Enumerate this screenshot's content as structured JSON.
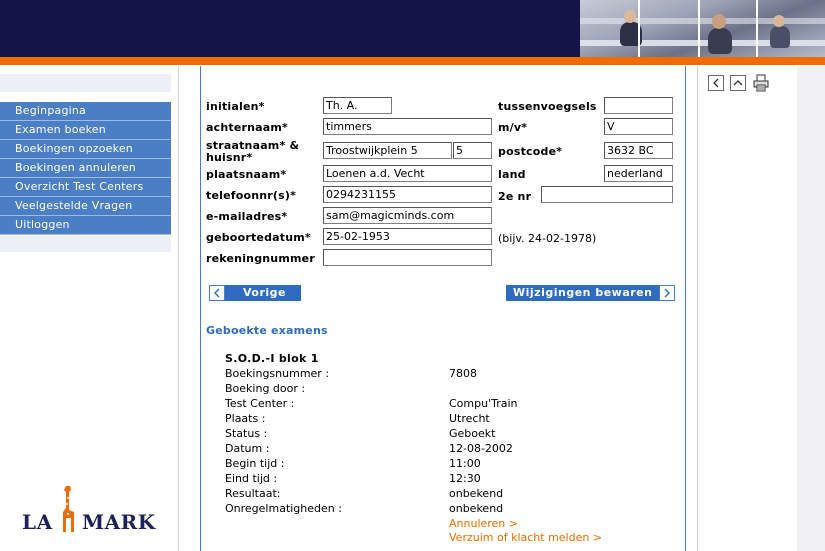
{
  "nav": {
    "items": [
      {
        "label": "Beginpagina"
      },
      {
        "label": "Examen boeken"
      },
      {
        "label": "Boekingen opzoeken"
      },
      {
        "label": "Boekingen annuleren"
      },
      {
        "label": "Overzicht Test Centers"
      },
      {
        "label": "Veelgestelde Vragen"
      },
      {
        "label": "Uitloggen"
      }
    ]
  },
  "logo": {
    "left": "LA",
    "right": "MARK"
  },
  "form": {
    "initialen": {
      "label": "initialen*",
      "value": "Th. A."
    },
    "tussenvoegsels": {
      "label": "tussenvoegsels",
      "value": ""
    },
    "achternaam": {
      "label": "achternaam*",
      "value": "timmers"
    },
    "mv": {
      "label": "m/v*",
      "value": "V"
    },
    "straat": {
      "label_1": "straatnaam* &",
      "label_2": "huisnr*",
      "value": "Troostwijkplein 5",
      "huisnr": "5"
    },
    "postcode": {
      "label": "postcode*",
      "value": "3632 BC"
    },
    "plaatsnaam": {
      "label": "plaatsnaam*",
      "value": "Loenen a.d. Vecht"
    },
    "land": {
      "label": "land",
      "value": "nederland"
    },
    "telefoon": {
      "label": "telefoonnr(s)*",
      "value": "0294231155"
    },
    "tweede_nr": {
      "label": "2e nr",
      "value": ""
    },
    "email": {
      "label": "e-mailadres*",
      "value": "sam@magicminds.com"
    },
    "geboortedatum": {
      "label": "geboortedatum*",
      "value": "25-02-1953",
      "hint": "(bijv. 24-02-1978)"
    },
    "rekeningnummer": {
      "label": "rekeningnummer",
      "value": ""
    }
  },
  "buttons": {
    "prev": "Vorige",
    "save": "Wijzigingen bewaren"
  },
  "booked": {
    "title": "Geboekte examens",
    "exam_title": "S.O.D.-I blok 1",
    "rows": [
      {
        "label": "Boekingsnummer :",
        "value": "7808"
      },
      {
        "label": "Boeking door :",
        "value": ""
      },
      {
        "label": "Test Center :",
        "value": "Compu'Train"
      },
      {
        "label": "Plaats :",
        "value": "Utrecht"
      },
      {
        "label": "Status :",
        "value": "Geboekt"
      },
      {
        "label": "Datum :",
        "value": "12-08-2002"
      },
      {
        "label": "Begin tijd :",
        "value": "11:00"
      },
      {
        "label": "Eind tijd :",
        "value": "12:30"
      },
      {
        "label": "Resultaat:",
        "value": "onbekend"
      },
      {
        "label": "Onregelmatigheden :",
        "value": "onbekend"
      }
    ],
    "link_cancel": "Annuleren >",
    "link_complaint": "Verzuim of klacht melden >"
  },
  "colors": {
    "header": "#141449",
    "accent": "#f26b00",
    "nav": "#4b7ec5",
    "button": "#2f6cc0"
  }
}
